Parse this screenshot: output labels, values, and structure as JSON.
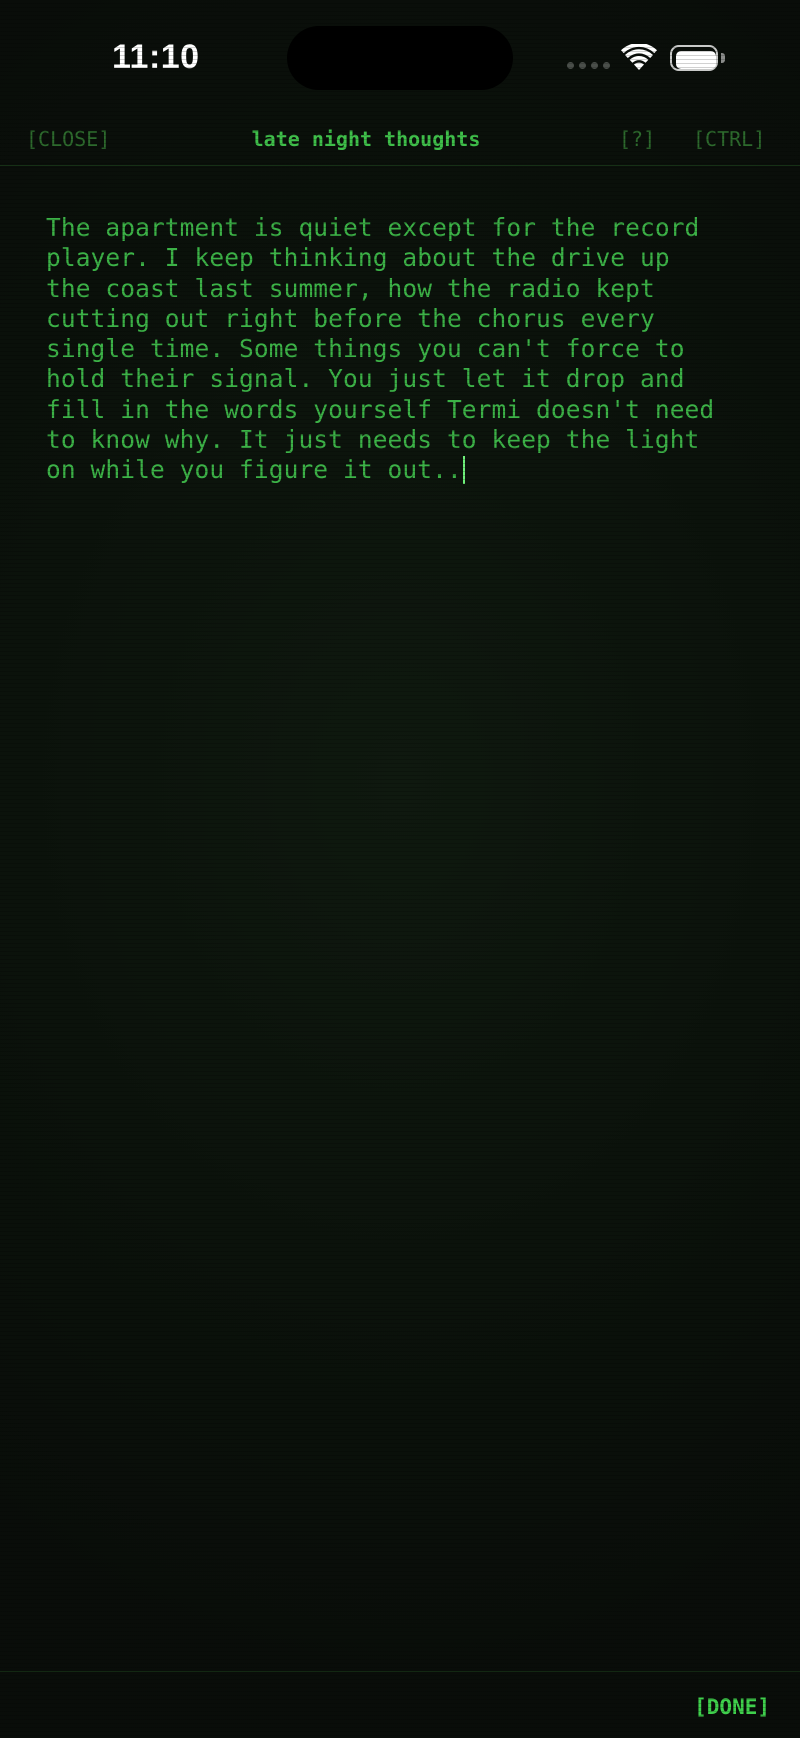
{
  "status_bar": {
    "time": "11:10",
    "wifi_icon": "wifi-icon",
    "battery_icon": "battery-icon",
    "signal_icon": "cellular-signal-icon"
  },
  "nav": {
    "close_label": "[CLOSE]",
    "title": "late night thoughts",
    "help_label": "[?]",
    "ctrl_label": "[CTRL]"
  },
  "editor": {
    "lines": [
      "The apartment is quiet except for the record",
      "player. I keep thinking about the drive up",
      "the coast last summer, how the radio kept",
      "cutting out right before the chorus every",
      "single time. Some things you can't force to",
      "hold their signal. You just let it drop and",
      "fill in the words yourself Termi doesn't need",
      "to know why. It just needs to keep the light",
      "on while you figure it out.."
    ]
  },
  "toolbar": {
    "done_label": "[DONE]"
  },
  "colors": {
    "background": "#0b120b",
    "text_green": "#3cb247",
    "title_green": "#3fbf4a",
    "dim_green": "#2d6a2d",
    "accent_green": "#3fd04c"
  }
}
